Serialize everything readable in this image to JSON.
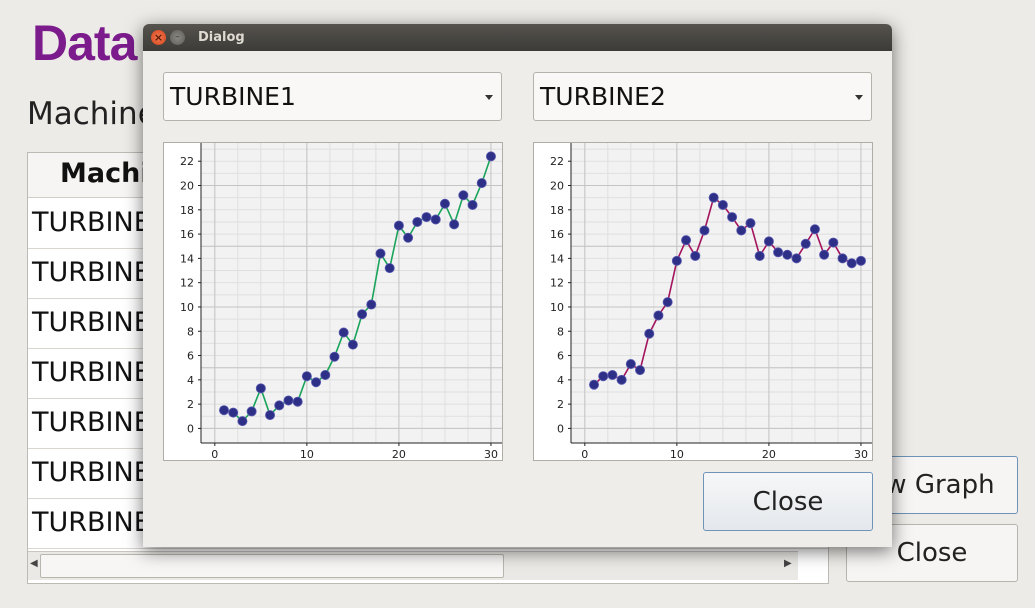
{
  "background": {
    "app_title": "Data",
    "subtitle": "Machine",
    "table": {
      "column_header": "Machin",
      "rows": [
        "TURBINE",
        "TURBINE",
        "TURBINE",
        "TURBINE",
        "TURBINE",
        "TURBINE",
        "TURBINE"
      ]
    },
    "buttons": {
      "show_graph": "ow Graph",
      "close": "Close"
    }
  },
  "dialog": {
    "title": "Dialog",
    "combo_left": {
      "selected": "TURBINE1"
    },
    "combo_right": {
      "selected": "TURBINE2"
    },
    "close_label": "Close"
  },
  "chart_data": [
    {
      "type": "line",
      "title": "",
      "xlabel": "",
      "ylabel": "",
      "xlim": [
        -1.5,
        31.2
      ],
      "ylim": [
        -1.2,
        23.5
      ],
      "x_ticks": [
        0,
        10,
        20,
        30
      ],
      "y_ticks": [
        0,
        2,
        4,
        6,
        8,
        10,
        12,
        14,
        16,
        18,
        20,
        22
      ],
      "grid": true,
      "line_color": "#1aa35a",
      "marker_color": "#2e2f86",
      "series": [
        {
          "x": [
            1,
            2,
            3,
            4,
            5,
            6,
            7,
            8,
            9,
            10,
            11,
            12,
            13,
            14,
            15,
            16,
            17,
            18,
            19,
            20,
            21,
            22,
            23,
            24,
            25,
            26,
            27,
            28,
            29,
            30
          ],
          "y": [
            1.5,
            1.3,
            0.6,
            1.4,
            3.3,
            1.1,
            1.9,
            2.3,
            2.2,
            4.3,
            3.8,
            4.4,
            5.9,
            7.9,
            6.9,
            9.4,
            10.2,
            14.4,
            13.2,
            16.7,
            15.7,
            17.0,
            17.4,
            17.2,
            18.5,
            16.8,
            19.2,
            18.4,
            20.2,
            22.4
          ]
        }
      ]
    },
    {
      "type": "line",
      "title": "",
      "xlabel": "",
      "ylabel": "",
      "xlim": [
        -1.5,
        31.2
      ],
      "ylim": [
        -1.2,
        23.5
      ],
      "x_ticks": [
        0,
        10,
        20,
        30
      ],
      "y_ticks": [
        0,
        2,
        4,
        6,
        8,
        10,
        12,
        14,
        16,
        18,
        20,
        22
      ],
      "grid": true,
      "line_color": "#a3145e",
      "marker_color": "#2e2f86",
      "series": [
        {
          "x": [
            1,
            2,
            3,
            4,
            5,
            6,
            7,
            8,
            9,
            10,
            11,
            12,
            13,
            14,
            15,
            16,
            17,
            18,
            19,
            20,
            21,
            22,
            23,
            24,
            25,
            26,
            27,
            28,
            29,
            30
          ],
          "y": [
            3.6,
            4.3,
            4.4,
            4.0,
            5.3,
            4.8,
            7.8,
            9.3,
            10.4,
            13.8,
            15.5,
            14.2,
            16.3,
            19.0,
            18.4,
            17.4,
            16.3,
            16.9,
            14.2,
            15.4,
            14.5,
            14.3,
            14.0,
            15.2,
            16.4,
            14.3,
            15.3,
            14.0,
            13.6,
            13.8
          ]
        }
      ]
    }
  ]
}
